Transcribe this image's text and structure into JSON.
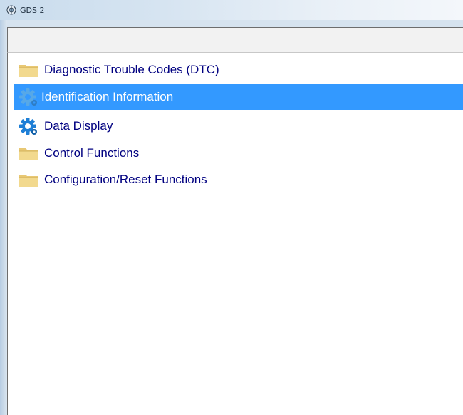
{
  "window": {
    "title": "GDS 2",
    "icon": "gds-app-icon"
  },
  "colors": {
    "selection": "#3399ff",
    "item_text": "#000080",
    "selected_text": "#ffffff"
  },
  "menu": {
    "items": [
      {
        "label": "Diagnostic Trouble Codes (DTC)",
        "icon": "folder-icon",
        "selected": false
      },
      {
        "label": "Identification Information",
        "icon": "gear-icon",
        "selected": true
      },
      {
        "label": "Data Display",
        "icon": "gear-icon",
        "selected": false
      },
      {
        "label": "Control Functions",
        "icon": "folder-icon",
        "selected": false
      },
      {
        "label": "Configuration/Reset Functions",
        "icon": "folder-icon",
        "selected": false
      }
    ]
  }
}
